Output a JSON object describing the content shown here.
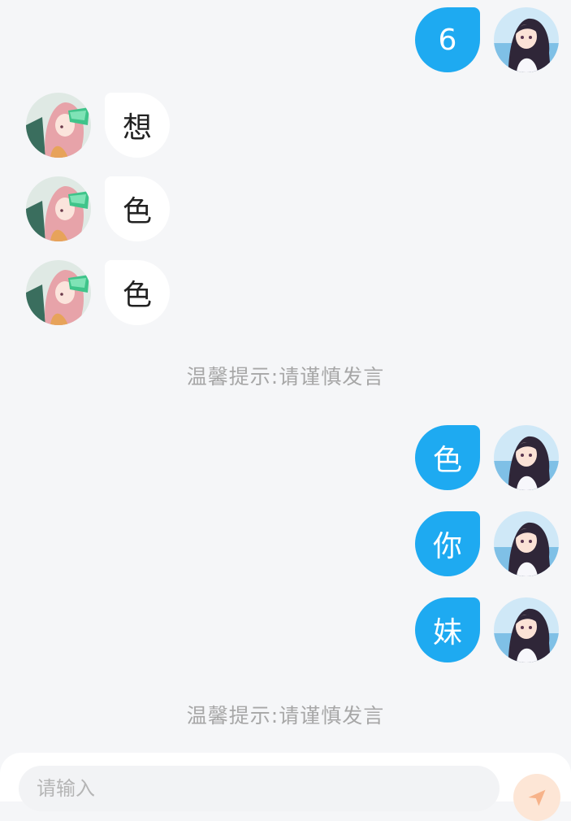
{
  "messages": [
    {
      "side": "right",
      "text": "6"
    },
    {
      "side": "left",
      "text": "想"
    },
    {
      "side": "left",
      "text": "色"
    },
    {
      "side": "left",
      "text": "色"
    },
    {
      "side": "right",
      "text": "色"
    },
    {
      "side": "right",
      "text": "你"
    },
    {
      "side": "right",
      "text": "妹"
    }
  ],
  "notice": "温馨提示:请谨慎发言",
  "input": {
    "placeholder": "请输入"
  },
  "colors": {
    "self_bubble": "#1eaaf1",
    "other_bubble": "#ffffff",
    "background": "#f5f6f8",
    "send_button": "#fde6d6"
  },
  "icons": {
    "self_avatar": "girl-avatar",
    "other_avatar": "pink-hair-avatar",
    "send": "send-icon"
  }
}
